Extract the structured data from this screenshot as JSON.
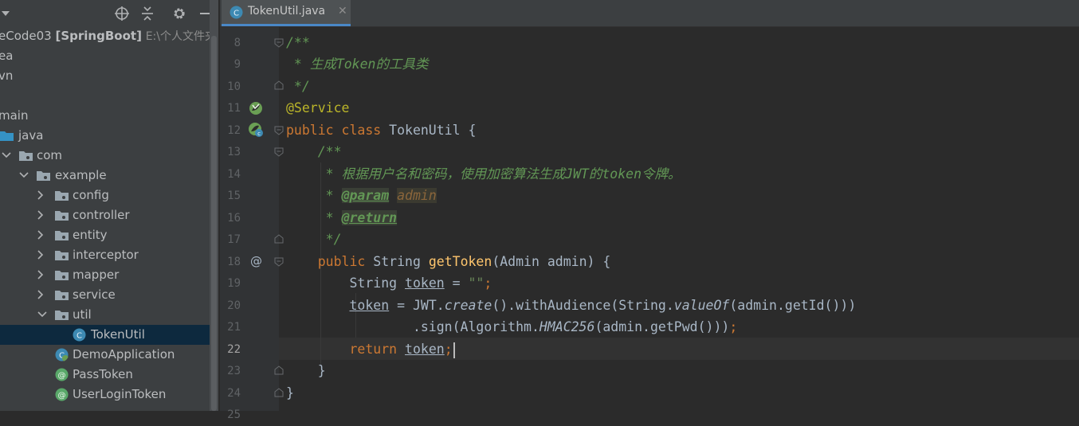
{
  "project": {
    "root_name": "eCode03",
    "root_module": "[SpringBoot]",
    "root_path": "E:\\个人文件夹\\",
    "tree": [
      {
        "label": "ea"
      },
      {
        "label": "vn"
      },
      {
        "label": ""
      },
      {
        "label": "main"
      },
      {
        "label": "java"
      },
      {
        "label": "com"
      },
      {
        "label": "example"
      },
      {
        "label": "config"
      },
      {
        "label": "controller"
      },
      {
        "label": "entity"
      },
      {
        "label": "interceptor"
      },
      {
        "label": "mapper"
      },
      {
        "label": "service"
      },
      {
        "label": "util"
      },
      {
        "label": "TokenUtil"
      },
      {
        "label": "DemoApplication"
      },
      {
        "label": "PassToken"
      },
      {
        "label": "UserLoginToken"
      }
    ]
  },
  "editor": {
    "tab_label": "TokenUtil.java",
    "tab_close": "✕",
    "current_line": 22,
    "line_numbers": [
      "8",
      "9",
      "10",
      "11",
      "12",
      "13",
      "14",
      "15",
      "16",
      "17",
      "18",
      "19",
      "20",
      "21",
      "22",
      "23",
      "24",
      "25"
    ],
    "code": {
      "l8": "/**",
      "l9_a": " * ",
      "l9_b": "生成Token的工具类",
      "l10": " */",
      "l11": "@Service",
      "l12_kw": "public class ",
      "l12_name": "TokenUtil {",
      "l13": "    /**",
      "l14": "     * 根据用户名和密码，使用加密算法生成JWT的token令牌。",
      "l15_pre": "     * ",
      "l15_tag": "@param",
      "l15_arg": "admin",
      "l16_pre": "     * ",
      "l16_tag": "@return",
      "l17": "     */",
      "l18_kw": "    public ",
      "l18_type": "String ",
      "l18_fn": "getToken",
      "l18_rest": "(Admin admin) {",
      "l19_a": "        String ",
      "l19_var": "token",
      "l19_b": " = ",
      "l19_str": "\"\"",
      "l19_semi": ";",
      "l20_pre": "        ",
      "l20_var": "token",
      "l20_a": " = JWT.",
      "l20_m1": "create",
      "l20_b": "().withAudience(String.",
      "l20_m2": "valueOf",
      "l20_c": "(admin.getId()))",
      "l21_a": "                .sign(Algorithm.",
      "l21_m": "HMAC256",
      "l21_b": "(admin.getPwd()))",
      "l21_semi": ";",
      "l22_kw": "        return ",
      "l22_var": "token",
      "l22_semi": ";",
      "l23": "    }",
      "l24": "}"
    }
  },
  "colors": {
    "panel_bg": "#3c3f41",
    "editor_bg": "#2b2b2b",
    "selection": "#0d293e",
    "keyword": "#cc7832",
    "annotation": "#bbb529",
    "method": "#ffc66d",
    "comment": "#629755",
    "string": "#6a8759"
  },
  "icons": [
    "chevron-down-icon",
    "crosshair-icon",
    "collapse-all-icon",
    "gear-icon",
    "minimize-icon",
    "folder-icon",
    "class-icon",
    "annotation-icon",
    "spring-bean-icon",
    "override-marker-icon"
  ]
}
